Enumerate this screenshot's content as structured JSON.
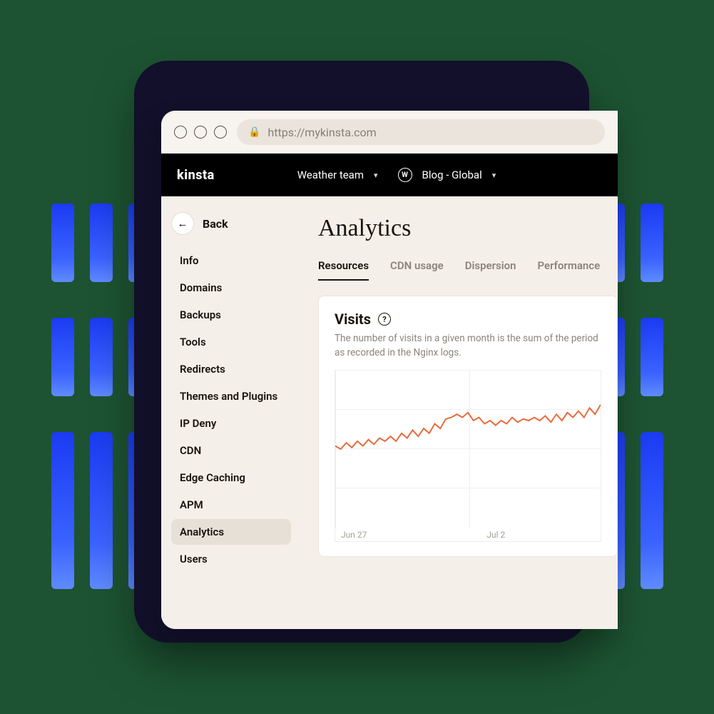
{
  "browser": {
    "url": "https://mykinsta.com"
  },
  "appbar": {
    "logo": "kinsta",
    "team_dropdown": "Weather team",
    "site_dropdown": "Blog - Global"
  },
  "sidebar": {
    "back_label": "Back",
    "items": [
      {
        "label": "Info"
      },
      {
        "label": "Domains"
      },
      {
        "label": "Backups"
      },
      {
        "label": "Tools"
      },
      {
        "label": "Redirects"
      },
      {
        "label": "Themes and Plugins"
      },
      {
        "label": "IP Deny"
      },
      {
        "label": "CDN"
      },
      {
        "label": "Edge Caching"
      },
      {
        "label": "APM"
      },
      {
        "label": "Analytics",
        "active": true
      },
      {
        "label": "Users"
      }
    ]
  },
  "main": {
    "title": "Analytics",
    "tabs": [
      {
        "label": "Resources",
        "active": true
      },
      {
        "label": "CDN usage"
      },
      {
        "label": "Dispersion"
      },
      {
        "label": "Performance"
      }
    ],
    "card": {
      "heading": "Visits",
      "description": "The number of visits in a given month is the sum of the period as recorded in the Nginx logs."
    }
  },
  "chart_data": {
    "type": "line",
    "title": "Visits",
    "xlabel": "",
    "ylabel": "",
    "x_tick_labels": [
      "Jun 27",
      "Jul 2"
    ],
    "ylim": [
      0,
      100
    ],
    "series": [
      {
        "name": "Visits",
        "color": "#e86a3a",
        "values": [
          52,
          50,
          54,
          51,
          55,
          52,
          56,
          53,
          57,
          55,
          58,
          55,
          60,
          57,
          62,
          58,
          63,
          60,
          66,
          63,
          69,
          70,
          72,
          70,
          73,
          68,
          70,
          66,
          68,
          65,
          68,
          66,
          70,
          67,
          69,
          68,
          70,
          68,
          71,
          67,
          72,
          68,
          73,
          70,
          74,
          70,
          76,
          72,
          78
        ]
      }
    ]
  }
}
